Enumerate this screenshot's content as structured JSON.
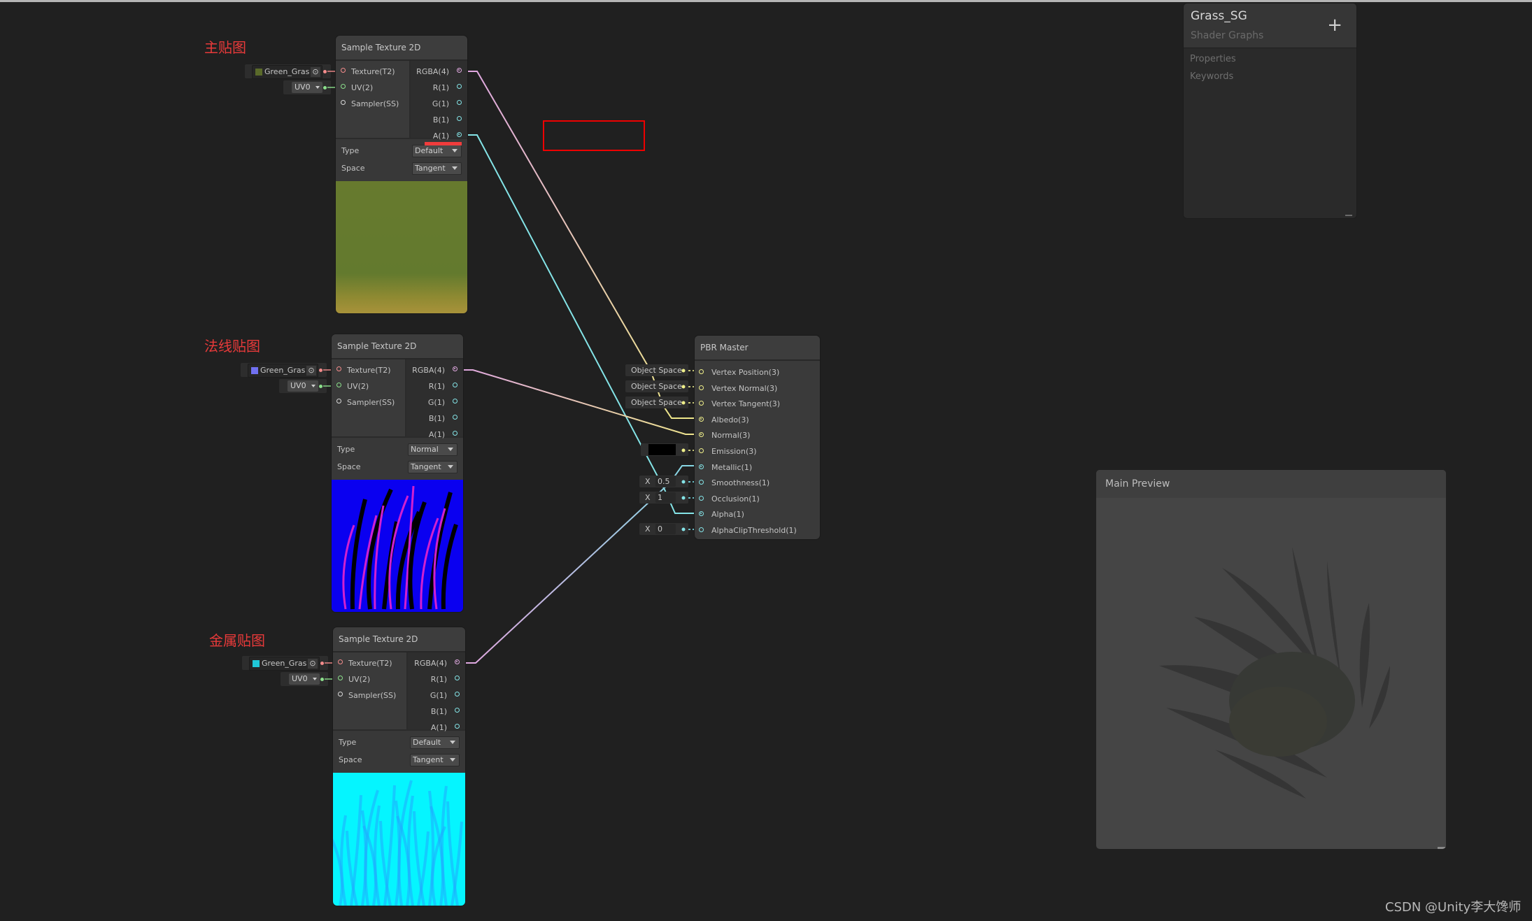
{
  "topstrip": true,
  "annotations": {
    "main_tex_label": "主贴图",
    "normal_tex_label": "法线贴图",
    "metal_tex_label": "金属贴图"
  },
  "nodes": [
    {
      "title": "Sample Texture 2D",
      "texture_asset": "Green_Gras",
      "texture_swatch_color": "#5a6a2a",
      "uv_channel": "UV0",
      "inputs": [
        "Texture(T2)",
        "UV(2)",
        "Sampler(SS)"
      ],
      "outputs": [
        "RGBA(4)",
        "R(1)",
        "G(1)",
        "B(1)",
        "A(1)"
      ],
      "type_label": "Type",
      "type_value": "Default",
      "space_label": "Space",
      "space_value": "Tangent",
      "preview_kind": "albedo"
    },
    {
      "title": "Sample Texture 2D",
      "texture_asset": "Green_Gras",
      "texture_swatch_color": "#7070f0",
      "uv_channel": "UV0",
      "inputs": [
        "Texture(T2)",
        "UV(2)",
        "Sampler(SS)"
      ],
      "outputs": [
        "RGBA(4)",
        "R(1)",
        "G(1)",
        "B(1)",
        "A(1)"
      ],
      "type_label": "Type",
      "type_value": "Normal",
      "space_label": "Space",
      "space_value": "Tangent",
      "preview_kind": "normal"
    },
    {
      "title": "Sample Texture 2D",
      "texture_asset": "Green_Gras",
      "texture_swatch_color": "#20c8d8",
      "uv_channel": "UV0",
      "inputs": [
        "Texture(T2)",
        "UV(2)",
        "Sampler(SS)"
      ],
      "outputs": [
        "RGBA(4)",
        "R(1)",
        "G(1)",
        "B(1)",
        "A(1)"
      ],
      "type_label": "Type",
      "type_value": "Default",
      "space_label": "Space",
      "space_value": "Tangent",
      "preview_kind": "metal"
    }
  ],
  "pbr_master": {
    "title": "PBR Master",
    "ports": [
      "Vertex Position(3)",
      "Vertex Normal(3)",
      "Vertex Tangent(3)",
      "Albedo(3)",
      "Normal(3)",
      "Emission(3)",
      "Metallic(1)",
      "Smoothness(1)",
      "Occlusion(1)",
      "Alpha(1)",
      "AlphaClipThreshold(1)"
    ],
    "vertex_position_space": "Object Space",
    "vertex_normal_space": "Object Space",
    "vertex_tangent_space": "Object Space",
    "emission_color": "#000000",
    "smoothness_axis": "X",
    "smoothness_value": "0.5",
    "occlusion_axis": "X",
    "occlusion_value": "1",
    "alpha_clip_axis": "X",
    "alpha_clip_value": "0"
  },
  "connections": [
    {
      "from": "node1.RGBA(4)",
      "to": "pbr.Albedo(3)"
    },
    {
      "from": "node1.A(1)",
      "to": "pbr.Alpha(1)"
    },
    {
      "from": "node2.RGBA(4)",
      "to": "pbr.Normal(3)"
    },
    {
      "from": "node3.RGBA(4)",
      "to": "pbr.Metallic(1)"
    }
  ],
  "blackboard": {
    "title": "Grass_SG",
    "subtitle": "Shader Graphs",
    "add_icon": "+",
    "sections": [
      "Properties",
      "Keywords"
    ]
  },
  "main_preview": {
    "title": "Main Preview"
  },
  "watermark": "CSDN @Unity李大馋师",
  "colors": {
    "background": "#202020",
    "node_bg": "#393939",
    "port_vector4": "#e0a8e0",
    "port_vector3": "#f0f08a",
    "port_vector1": "#84e4e7",
    "port_texture": "#f58c8c",
    "port_uv": "#8ce08c",
    "annotation_red": "#e83a3a"
  }
}
